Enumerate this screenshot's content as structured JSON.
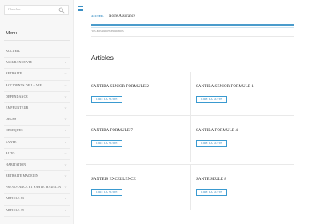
{
  "search": {
    "placeholder": "Chercher"
  },
  "sidebar": {
    "title": "Menu",
    "items": [
      {
        "label": "ACCUEIL",
        "has_chevron": false
      },
      {
        "label": "ASSURANCE VIE",
        "has_chevron": true
      },
      {
        "label": "RETRAITE",
        "has_chevron": true
      },
      {
        "label": "ACCIDENTS DE LA VIE",
        "has_chevron": true
      },
      {
        "label": "DEPENDANCE",
        "has_chevron": true
      },
      {
        "label": "EMPRUNTEUR",
        "has_chevron": true
      },
      {
        "label": "DECES",
        "has_chevron": true
      },
      {
        "label": "OBSEQUES",
        "has_chevron": true
      },
      {
        "label": "SANTE",
        "has_chevron": true
      },
      {
        "label": "AUTO",
        "has_chevron": true
      },
      {
        "label": "HABITATION",
        "has_chevron": true
      },
      {
        "label": "RETRAITE MADELIN",
        "has_chevron": true
      },
      {
        "label": "PREVOYANCE ET SANTE MADELIN",
        "has_chevron": true
      },
      {
        "label": "ARTICLE 83",
        "has_chevron": true
      },
      {
        "label": "ARTICLE 39",
        "has_chevron": true
      }
    ]
  },
  "breadcrumb": {
    "home": "ACCUEIL",
    "current": "Notre Assurance"
  },
  "main": {
    "caption": "Vos avis sur les assurances",
    "section_title": "Articles",
    "button_label": "LIRE LA SUITE",
    "cards": [
      {
        "title": "SANTIBA SENIOR FORMULE 2"
      },
      {
        "title": "SANTIBA SENIOR FORMULE 1"
      },
      {
        "title": "SANTIBA FORMULE 7"
      },
      {
        "title": "SANTIBA FORMULE 4"
      },
      {
        "title": "SANTEIS EXCELLENCE"
      },
      {
        "title": "SANTE SEULE 8"
      }
    ]
  },
  "colors": {
    "accent": "#3a8fc4",
    "sidebar_bg": "#f7f7f7"
  }
}
